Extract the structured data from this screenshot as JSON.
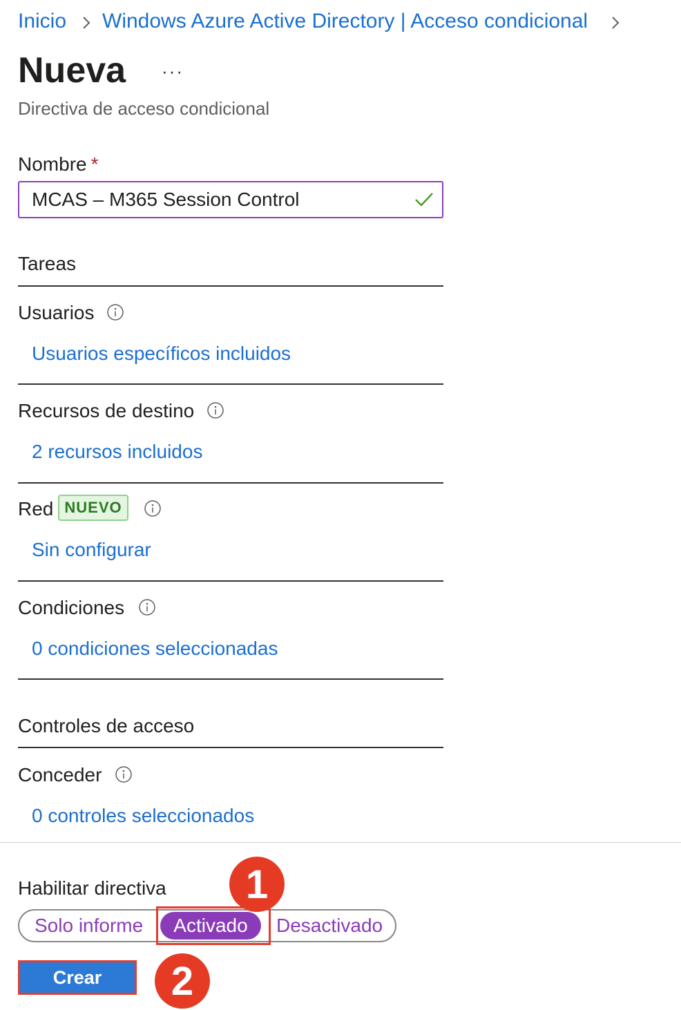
{
  "breadcrumb": {
    "items": [
      "Inicio",
      "Windows Azure Active Directory | Acceso condicional"
    ]
  },
  "header": {
    "title": "Nueva",
    "more": "···",
    "subtitle": "Directiva de acceso condicional"
  },
  "name_field": {
    "label": "Nombre",
    "required_mark": "*",
    "value": "MCAS – M365 Session Control"
  },
  "assignments": {
    "heading": "Tareas",
    "users": {
      "label": "Usuarios",
      "link": "Usuarios específicos incluidos"
    },
    "target_resources": {
      "label": "Recursos de destino",
      "link": "2 recursos incluidos"
    },
    "network": {
      "label": "Red",
      "badge": "NUEVO",
      "link": "Sin configurar"
    },
    "conditions": {
      "label": "Condiciones",
      "link": "0 condiciones seleccionadas"
    }
  },
  "access_controls": {
    "heading": "Controles de acceso",
    "grant": {
      "label": "Conceder",
      "link": "0 controles seleccionados"
    }
  },
  "enable_policy": {
    "label": "Habilitar directiva",
    "options": [
      "Solo informe",
      "Activado",
      "Desactivado"
    ],
    "selected": "Activado"
  },
  "create_button": "Crear",
  "markers": [
    "1",
    "2"
  ],
  "colors": {
    "link": "#1b6fd0",
    "accent_purple": "#8a3cb8",
    "primary_button": "#2d7ad6",
    "highlight_red": "#e63b2e",
    "badge_green": "#2d7a22"
  }
}
